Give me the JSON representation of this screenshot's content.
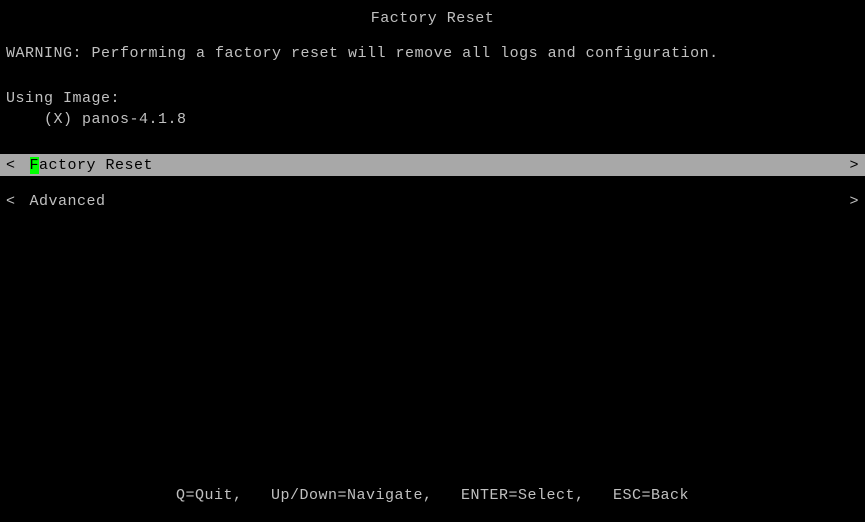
{
  "title": "Factory Reset",
  "warning": "WARNING: Performing a factory reset will remove all logs and configuration.",
  "using_image_label": "Using Image:",
  "image_entry": "    (X) panos-4.1.8",
  "menu": {
    "factory_reset": {
      "left": "<",
      "hotkey": "F",
      "rest": "actory Reset",
      "right": ">"
    },
    "advanced": {
      "left": "<",
      "label": " Advanced",
      "right": ">"
    }
  },
  "footer": "Q=Quit,   Up/Down=Navigate,   ENTER=Select,   ESC=Back"
}
